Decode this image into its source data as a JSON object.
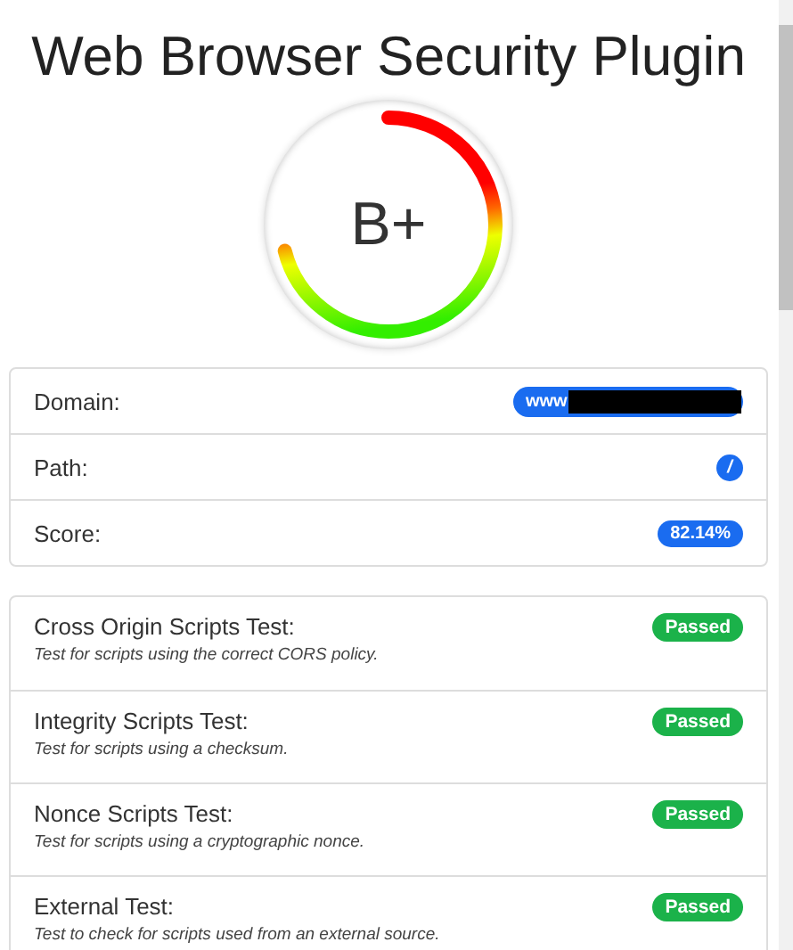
{
  "title": "Web Browser Security Plugin",
  "gauge": {
    "grade": "B+"
  },
  "info": [
    {
      "label": "Domain:",
      "value": "www",
      "kind": "redacted"
    },
    {
      "label": "Path:",
      "value": "/",
      "kind": "round"
    },
    {
      "label": "Score:",
      "value": "82.14%",
      "kind": "pill"
    }
  ],
  "tests": [
    {
      "name": "Cross Origin Scripts Test:",
      "description": "Test for scripts using the correct CORS policy.",
      "status": "Passed",
      "passed": true
    },
    {
      "name": "Integrity Scripts Test:",
      "description": "Test for scripts using a checksum.",
      "status": "Passed",
      "passed": true
    },
    {
      "name": "Nonce Scripts Test:",
      "description": "Test for scripts using a cryptographic nonce.",
      "status": "Passed",
      "passed": true
    },
    {
      "name": "External Test:",
      "description": "Test to check for scripts used from an external source.",
      "status": "Passed",
      "passed": true
    }
  ]
}
